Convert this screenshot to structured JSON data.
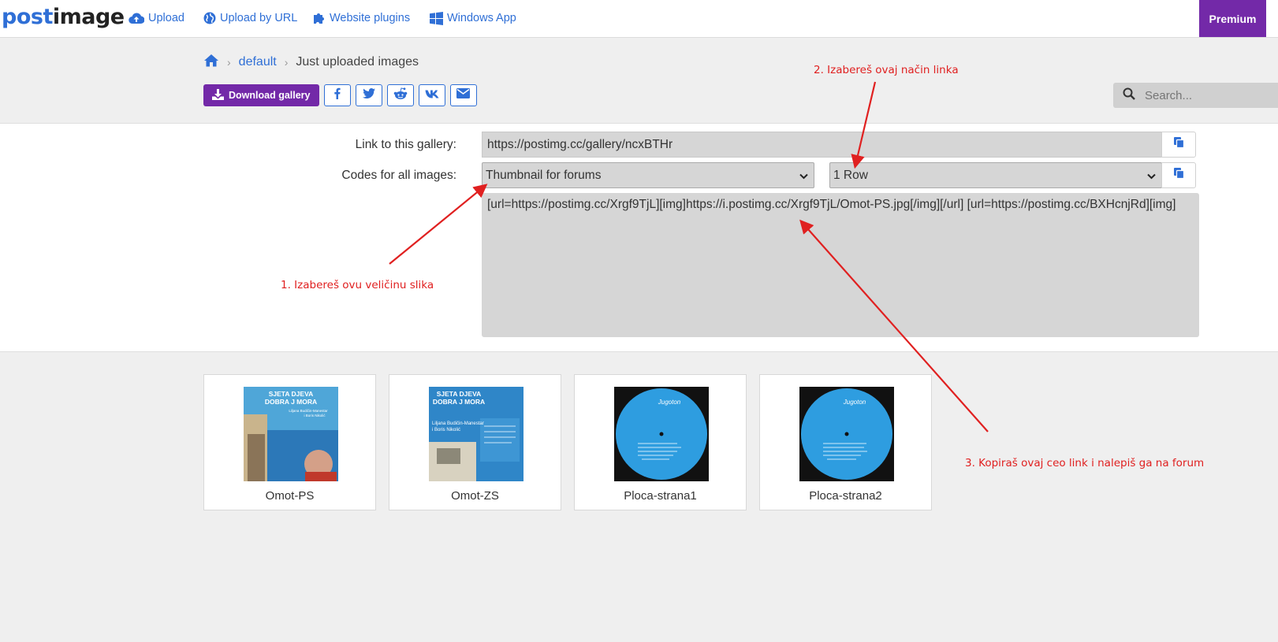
{
  "nav": {
    "logo_part1": "post",
    "logo_part2": "image",
    "upload": "Upload",
    "upload_url": "Upload by URL",
    "plugins": "Website plugins",
    "windows_app": "Windows App",
    "premium": "Premium"
  },
  "breadcrumb": {
    "home_icon": "home-icon",
    "folder": "default",
    "current": "Just uploaded images"
  },
  "toolbar": {
    "download": "Download gallery",
    "share_icons": [
      "facebook-icon",
      "twitter-icon",
      "reddit-icon",
      "vk-icon",
      "email-icon"
    ]
  },
  "search": {
    "placeholder": "Search..."
  },
  "form": {
    "gallery_label": "Link to this gallery:",
    "gallery_value": "https://postimg.cc/gallery/ncxBTHr",
    "codes_label": "Codes for all images:",
    "size_select": "Thumbnail for forums",
    "layout_select": "1 Row",
    "code_text": "[url=https://postimg.cc/Xrgf9TjL][img]https://i.postimg.cc/Xrgf9TjL/Omot-PS.jpg[/img][/url] [url=https://postimg.cc/BXHcnjRd][img]"
  },
  "gallery": [
    {
      "caption": "Omot-PS"
    },
    {
      "caption": "Omot-ZS"
    },
    {
      "caption": "Ploca-strana1"
    },
    {
      "caption": "Ploca-strana2"
    }
  ],
  "thumb_texts": {
    "album_title_1": "SJETA DJEVA",
    "album_title_2": "DOBRA J MORA",
    "artists_1": "Liljana Budičin-Manestar",
    "artists_2": "i Boris Nikolić",
    "label": "Jugoton"
  },
  "annotations": {
    "note1": "1. Izabereš ovu veličinu slika",
    "note2": "2. Izabereš ovaj način linka",
    "note3": "3. Kopiraš ovaj ceo link i nalepiš ga na forum"
  },
  "colors": {
    "brand_blue": "#2f6fd6",
    "premium_purple": "#7329a8",
    "annotation_red": "#e02020"
  }
}
